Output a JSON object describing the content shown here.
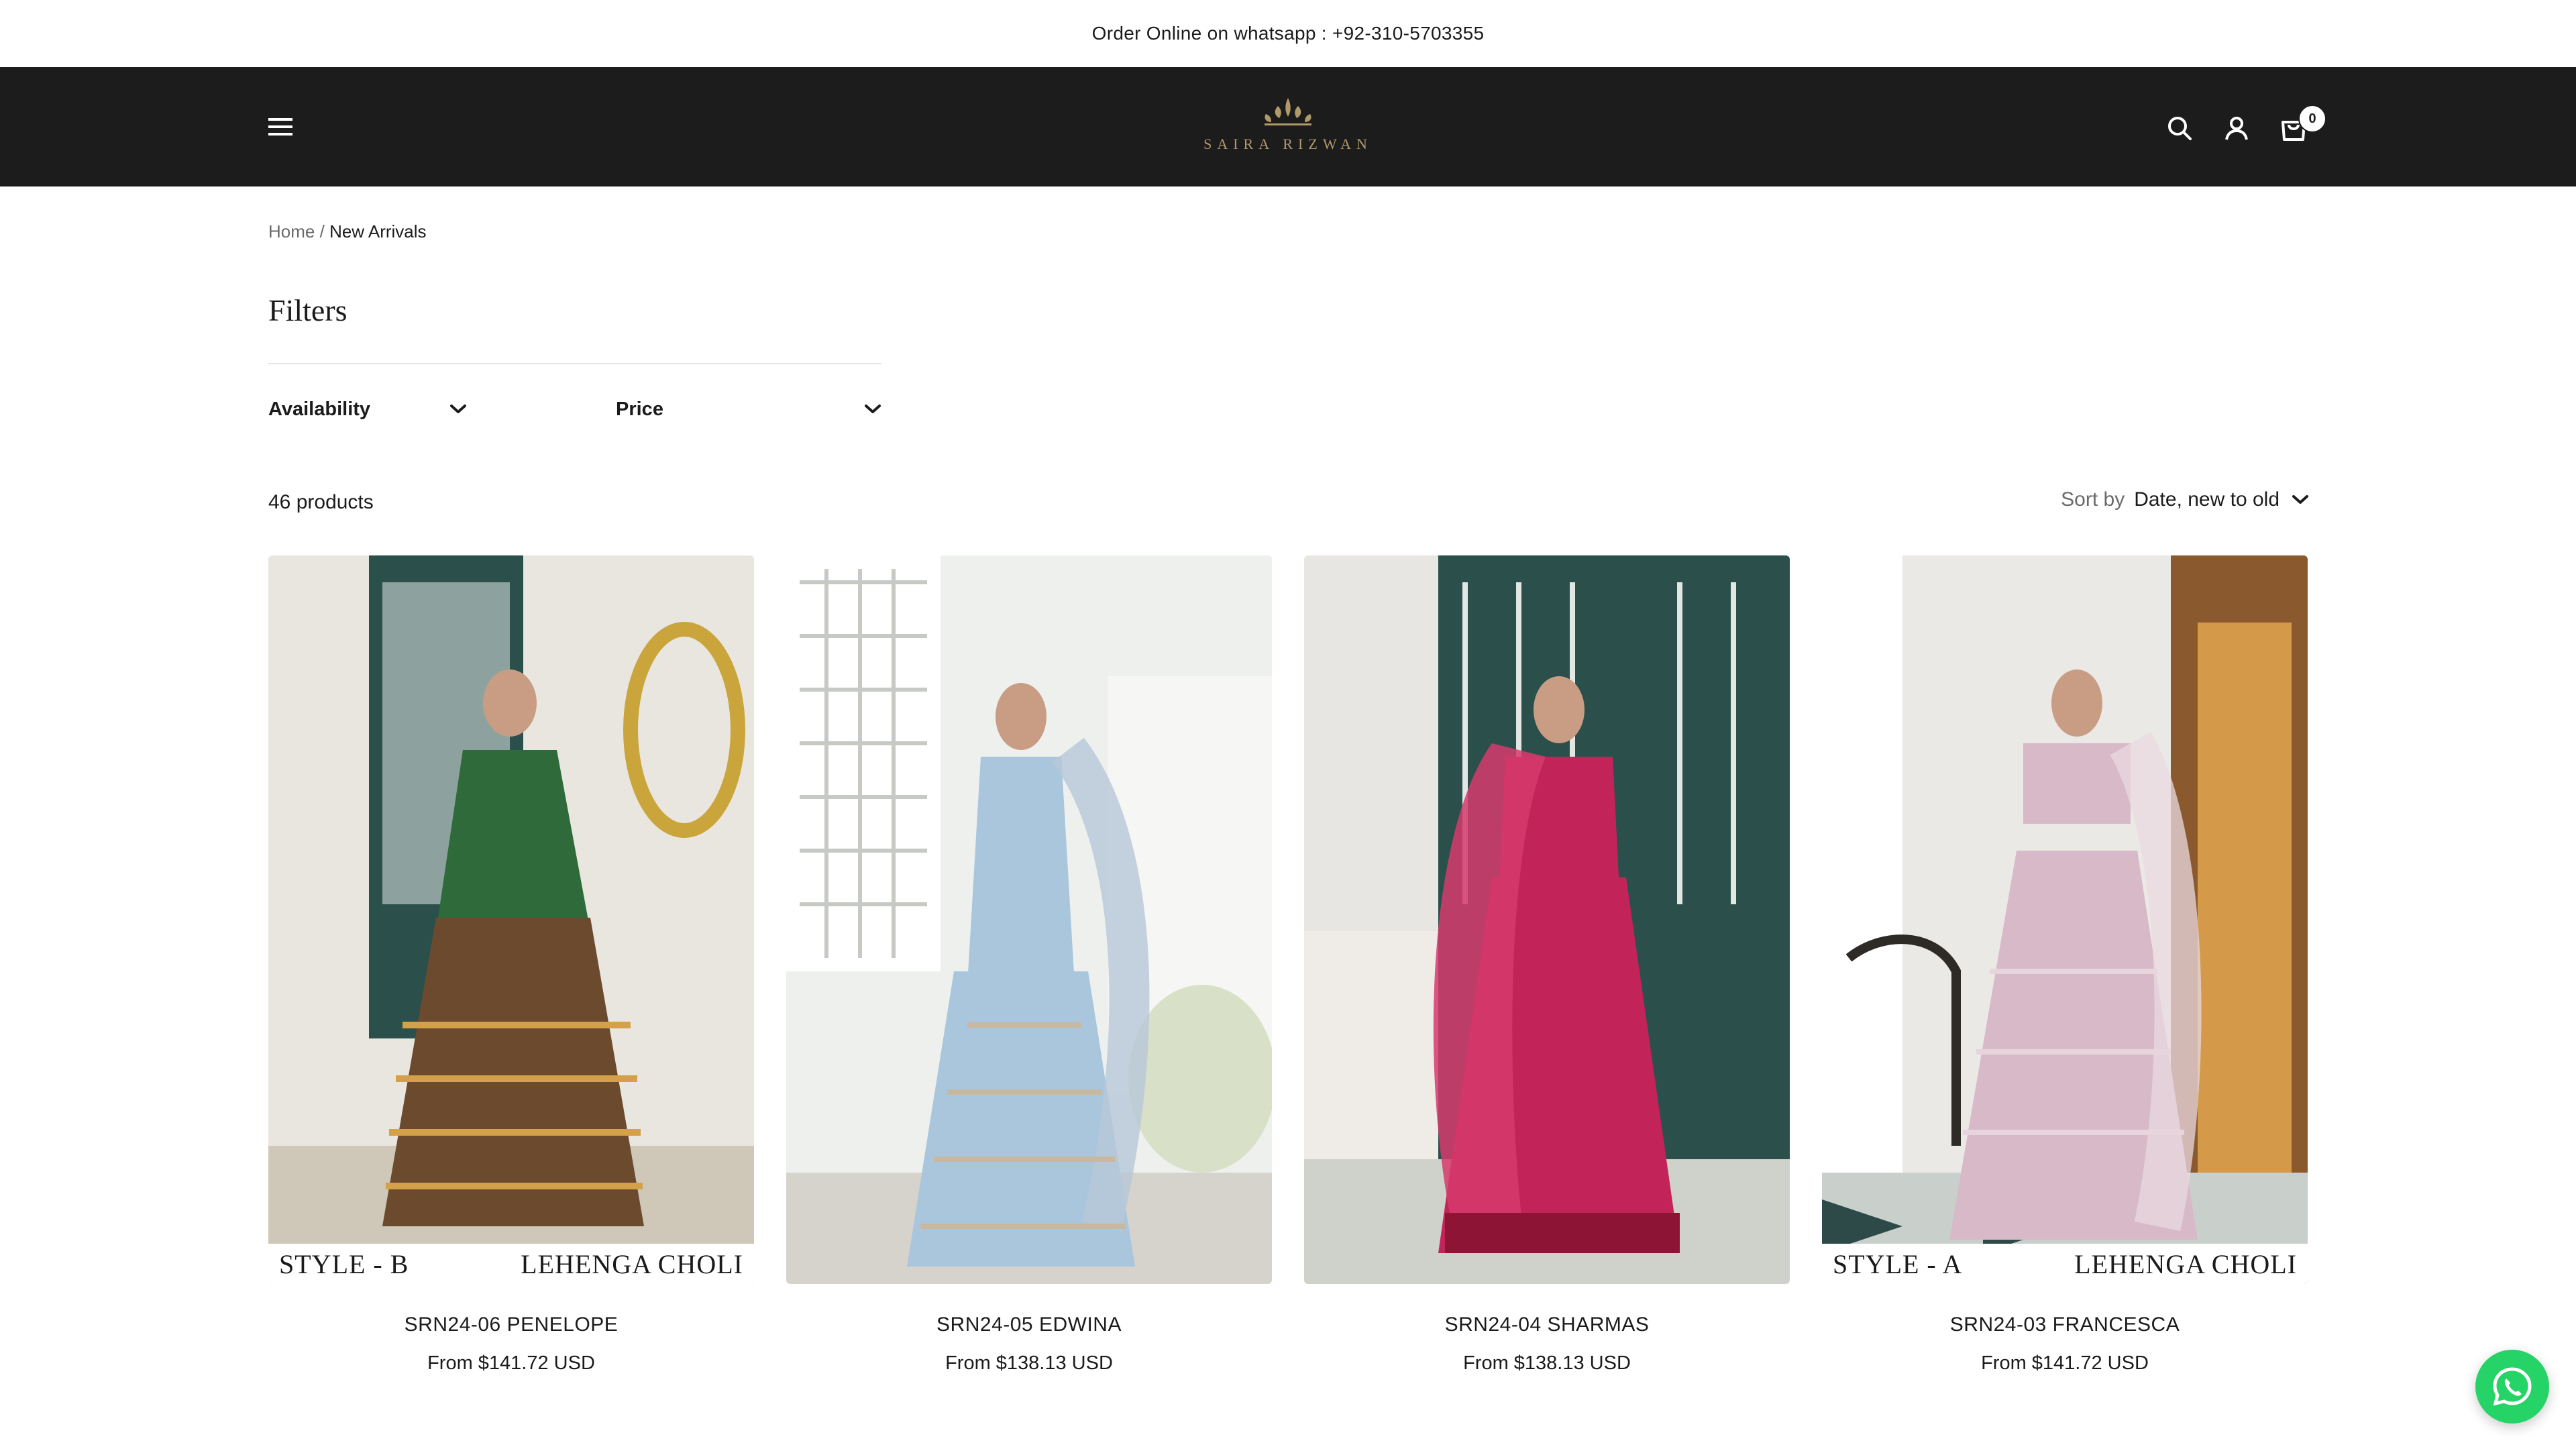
{
  "announcement": "Order Online on whatsapp : +92-310-5703355",
  "header": {
    "logo_text": "SAIRA RIZWAN",
    "cart_count": "0"
  },
  "breadcrumb": {
    "home": "Home",
    "separator": "/",
    "current": "New Arrivals"
  },
  "filters": {
    "title": "Filters",
    "availability_label": "Availability",
    "price_label": "Price"
  },
  "toolbar": {
    "product_count": "46 products",
    "sort_label": "Sort by",
    "sort_value": "Date, new to old"
  },
  "products": [
    {
      "name": "SRN24-06 PENELOPE",
      "price": "From $141.72 USD",
      "caption_left": "STYLE - B",
      "caption_right": "LEHENGA CHOLI",
      "dress_color": "#6b4a2e",
      "accent_color": "#2f6b3a",
      "bg_color": "#e9e6e0"
    },
    {
      "name": "SRN24-05 EDWINA",
      "price": "From $138.13 USD",
      "caption_left": "",
      "caption_right": "",
      "dress_color": "#a9c6dc",
      "accent_color": "#c9b8a0",
      "bg_color": "#eef0ee"
    },
    {
      "name": "SRN24-04 SHARMAS",
      "price": "From $138.13 USD",
      "caption_left": "",
      "caption_right": "",
      "dress_color": "#c2245a",
      "accent_color": "#8e1436",
      "bg_color": "#e8e6e2"
    },
    {
      "name": "SRN24-03 FRANCESCA",
      "price": "From $141.72 USD",
      "caption_left": "STYLE - A",
      "caption_right": "LEHENGA CHOLI",
      "dress_color": "#d8b9c8",
      "accent_color": "#e8d4dc",
      "bg_color": "#ebe9e6"
    }
  ],
  "colors": {
    "header_bg": "#1c1c1c",
    "logo_gold": "#b09a6a",
    "whatsapp_green": "#25d366"
  }
}
